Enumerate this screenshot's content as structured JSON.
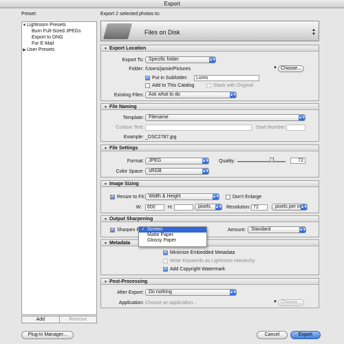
{
  "window": {
    "title": "Export"
  },
  "presets": {
    "label": "Preset:",
    "tree": [
      {
        "label": "Lightroom Presets",
        "expanded": true,
        "children": [
          "Burn Full-Sized JPEGs",
          "Export to DNG",
          "For E-Mail"
        ]
      },
      {
        "label": "User Presets",
        "expanded": false,
        "children": []
      }
    ],
    "add_label": "Add",
    "remove_label": "Remove"
  },
  "header": {
    "label": "Export 2 selected photos to:",
    "destination": "Files on Disk"
  },
  "export_location": {
    "title": "Export Location",
    "export_to_label": "Export To:",
    "export_to_value": "Specific folder",
    "folder_label": "Folder:",
    "folder_value": "/Users/jamie/Pictures",
    "choose_label": "Choose...",
    "subfolder_label": "Put in Subfolder:",
    "subfolder_value": "Lores",
    "subfolder_checked": true,
    "add_catalog_label": "Add to This Catalog",
    "add_catalog_checked": false,
    "stack_label": "Stack with Original",
    "stack_checked": false,
    "existing_label": "Existing Files:",
    "existing_value": "Ask what to do"
  },
  "file_naming": {
    "title": "File Naming",
    "template_label": "Template:",
    "template_value": "Filename",
    "custom_label": "Custom Text:",
    "custom_value": "",
    "start_label": "Start Number:",
    "start_value": "",
    "example_label": "Example:",
    "example_value": "_DSC2787.jpg"
  },
  "file_settings": {
    "title": "File Settings",
    "format_label": "Format:",
    "format_value": "JPEG",
    "quality_label": "Quality:",
    "quality_value": "72",
    "quality_fraction": 0.72,
    "colorspace_label": "Color Space:",
    "colorspace_value": "sRGB"
  },
  "image_sizing": {
    "title": "Image Sizing",
    "resize_label": "Resize to Fit:",
    "resize_checked": true,
    "resize_value": "Width & Height",
    "dont_enlarge_label": "Don't Enlarge",
    "dont_enlarge_checked": false,
    "w_label": "W:",
    "w_value": "600",
    "h_label": "H:",
    "h_value": "",
    "unit_value": "pixels",
    "resolution_label": "Resolution:",
    "resolution_value": "72",
    "resolution_unit": "pixels per inch"
  },
  "output_sharpening": {
    "title": "Output Sharpening",
    "sharpen_label": "Sharpen For:",
    "sharpen_checked": true,
    "menu_options": [
      "Screen",
      "Matte Paper",
      "Glossy Paper"
    ],
    "menu_selected": "Screen",
    "amount_label": "Amount:",
    "amount_value": "Standard"
  },
  "metadata": {
    "title": "Metadata",
    "minimize_label": "Minimize Embedded Metadata",
    "minimize_checked": true,
    "keywords_label": "Write Keywords as Lightroom Hierarchy",
    "keywords_checked": false,
    "watermark_label": "Add Copyright Watermark",
    "watermark_checked": true
  },
  "post_processing": {
    "title": "Post-Processing",
    "after_label": "After Export:",
    "after_value": "Do nothing",
    "app_label": "Application:",
    "app_placeholder": "Choose an application...",
    "choose_label": "Choose..."
  },
  "footer": {
    "plugin_label": "Plug-in Manager...",
    "cancel_label": "Cancel",
    "export_label": "Export"
  },
  "colors": {
    "accent": "#3167d6",
    "panel_header": "#d7d7d7"
  }
}
